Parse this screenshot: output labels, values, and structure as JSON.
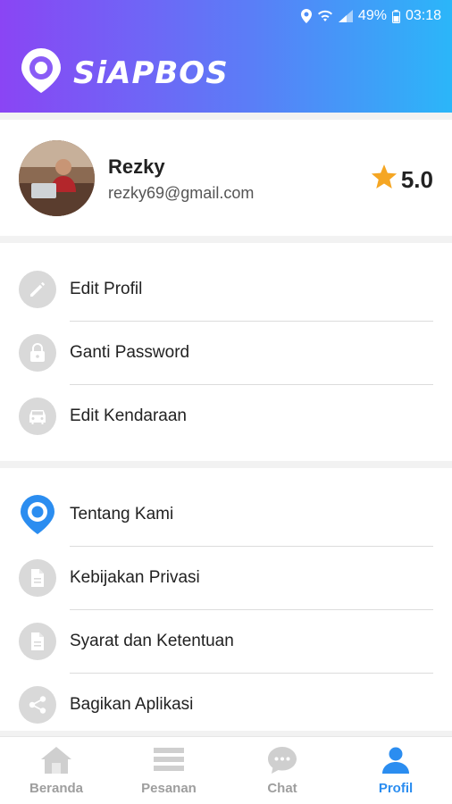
{
  "status": {
    "battery": "49%",
    "time": "03:18"
  },
  "app": {
    "name": "SiAPBOS"
  },
  "profile": {
    "name": "Rezky",
    "email": "rezky69@gmail.com",
    "rating": "5.0"
  },
  "menu_account": [
    {
      "label": "Edit Profil",
      "icon": "pencil-icon"
    },
    {
      "label": "Ganti Password",
      "icon": "lock-icon"
    },
    {
      "label": "Edit Kendaraan",
      "icon": "car-icon"
    }
  ],
  "menu_info": [
    {
      "label": "Tentang Kami",
      "icon": "app-logo-icon"
    },
    {
      "label": "Kebijakan Privasi",
      "icon": "document-icon"
    },
    {
      "label": "Syarat dan Ketentuan",
      "icon": "document-icon"
    },
    {
      "label": "Bagikan Aplikasi",
      "icon": "share-icon"
    }
  ],
  "nav": [
    {
      "label": "Beranda",
      "icon": "home-icon",
      "active": false
    },
    {
      "label": "Pesanan",
      "icon": "list-icon",
      "active": false
    },
    {
      "label": "Chat",
      "icon": "chat-icon",
      "active": false
    },
    {
      "label": "Profil",
      "icon": "person-icon",
      "active": true
    }
  ],
  "colors": {
    "accent": "#2b8df0",
    "star": "#f5a623",
    "gradient_start": "#8a45f4",
    "gradient_end": "#2bb6f9"
  }
}
